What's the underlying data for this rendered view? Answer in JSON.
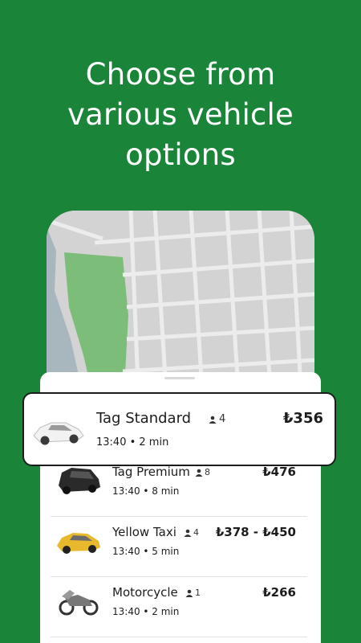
{
  "headline": {
    "line1": "Choose from",
    "line2": "various vehicle",
    "line3": "options"
  },
  "colors": {
    "brand_green": "#1a8439",
    "map_park": "#7cbd7a",
    "map_water": "#a8b6bd"
  },
  "selected_option": {
    "name": "Tag Standard",
    "capacity": "4",
    "price": "₺356",
    "eta": "13:40 • 2 min",
    "vehicle_icon": "white-sedan-icon"
  },
  "options": [
    {
      "name": "Tag Premium",
      "capacity": "8",
      "price": "₺476",
      "eta": "13:40 • 8 min",
      "vehicle_icon": "black-suv-icon"
    },
    {
      "name": "Yellow Taxi",
      "capacity": "4",
      "price": "₺378 - ₺450",
      "eta": "13:40 • 5 min",
      "vehicle_icon": "yellow-taxi-icon"
    },
    {
      "name": "Motorcycle",
      "capacity": "1",
      "price": "₺266",
      "eta": "13:40 • 2 min",
      "vehicle_icon": "motorcycle-icon"
    }
  ]
}
